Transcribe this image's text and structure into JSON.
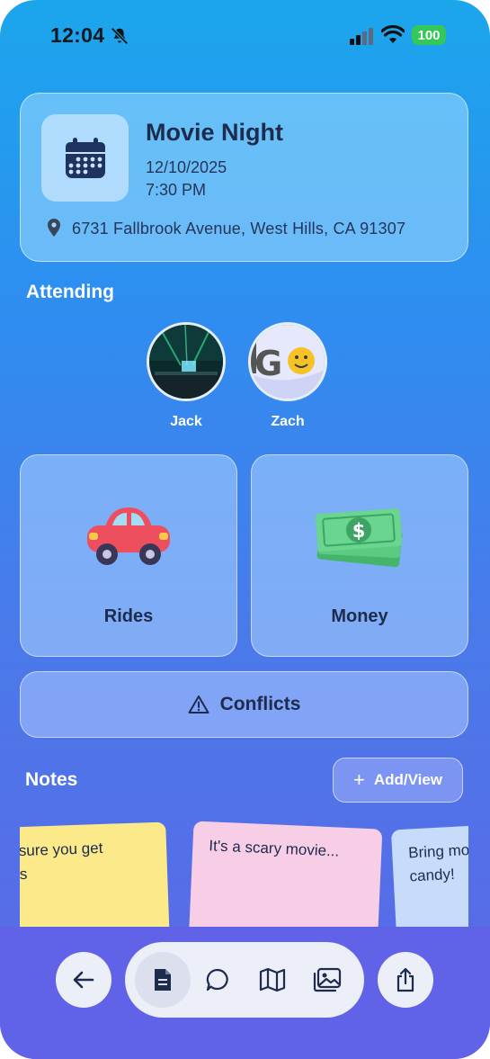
{
  "status_bar": {
    "time": "12:04",
    "battery": "100"
  },
  "event": {
    "title": "Movie Night",
    "date": "12/10/2025",
    "time": "7:30 PM",
    "address": "6731 Fallbrook Avenue, West Hills, CA 91307"
  },
  "attending": {
    "title": "Attending",
    "people": [
      {
        "name": "Jack",
        "avatar": "concert-photo"
      },
      {
        "name": "Zach",
        "avatar": "go-logo"
      }
    ]
  },
  "tiles": {
    "rides_label": "Rides",
    "money_label": "Money"
  },
  "conflicts": {
    "label": "Conflicts"
  },
  "notes": {
    "title": "Notes",
    "add_label": "Add/View",
    "items": [
      {
        "text": "ke sure you get\nkets",
        "color": "#fbe98a"
      },
      {
        "text": "It's a scary movie...",
        "color": "#f8cde6"
      },
      {
        "text": "Bring mo\ncandy!",
        "color": "#c6dcfa"
      }
    ]
  },
  "nav": {
    "back_icon": "arrow-left-icon",
    "tabs": [
      "document-icon",
      "chat-icon",
      "map-icon",
      "photos-icon"
    ],
    "share_icon": "share-icon"
  },
  "colors": {
    "accent": "#5d66e6",
    "text_dark": "#1d2b4c",
    "battery": "#34c759"
  }
}
